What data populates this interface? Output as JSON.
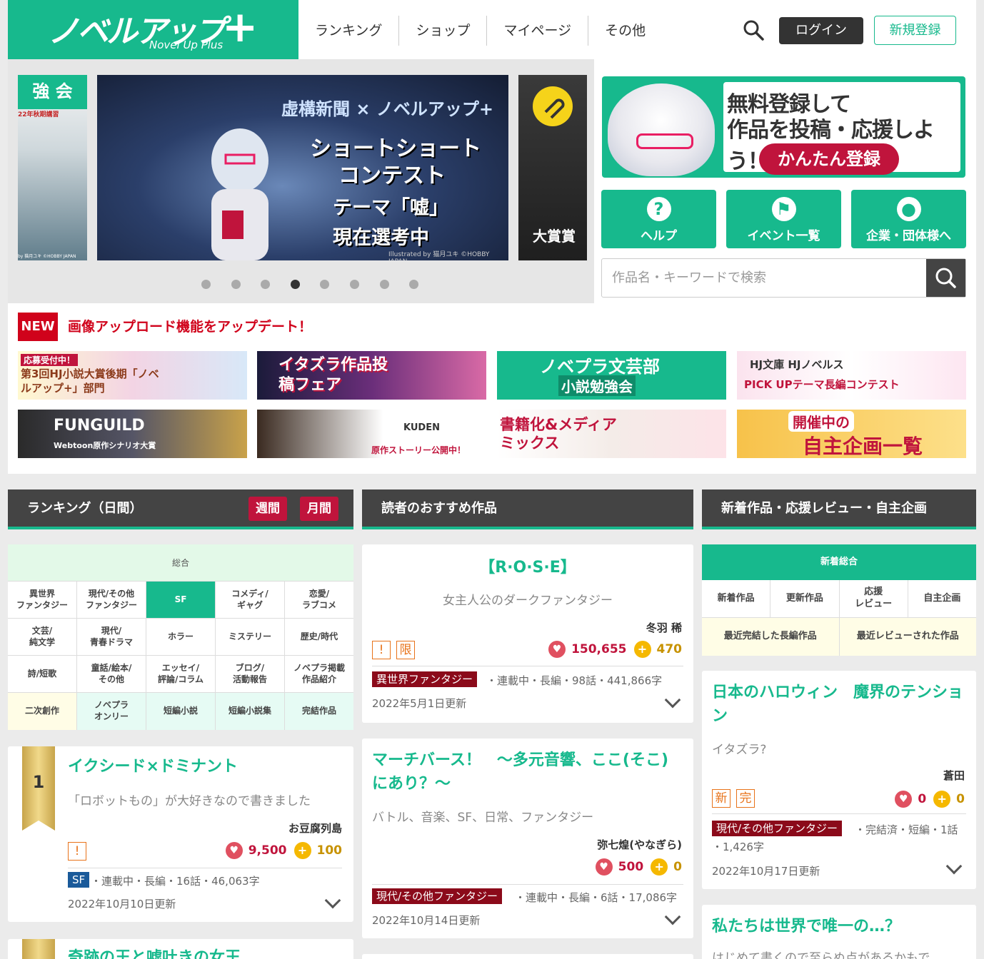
{
  "header": {
    "logo_main": "ノベルアップ",
    "logo_sub": "Novel Up Plus",
    "nav": [
      "ランキング",
      "ショップ",
      "マイページ",
      "その他"
    ],
    "login": "ログイン",
    "register": "新規登録"
  },
  "carousel": {
    "main_title": "虚構新聞 × ノベルアップ+",
    "main_line1": "ショートショート",
    "main_line2": "コンテスト",
    "main_line3": "テーマ「嘘」",
    "main_line4": "現在選考中",
    "main_credit": "Illustrated by 猫月ユキ ©HOBBY JAPAN",
    "left_head": "強 会",
    "left_sub": "22年秋期講習",
    "left_credit": "by 猫月ユキ ©HOBBY JAPAN",
    "right_award": "大賞賞",
    "dot_count": 8,
    "active_dot": 3
  },
  "signup": {
    "line1": "無料登録して",
    "line2": "作品を投稿・応援しよう！",
    "button": "かんたん登録"
  },
  "quick_links": [
    {
      "icon": "question-icon",
      "glyph": "?",
      "label": "ヘルプ"
    },
    {
      "icon": "flag-icon",
      "glyph": "⚑",
      "label": "イベント一覧"
    },
    {
      "icon": "person-icon",
      "glyph": "●",
      "label": "企業・団体様へ"
    }
  ],
  "search": {
    "placeholder": "作品名・キーワードで検索"
  },
  "news": {
    "badge": "NEW",
    "text": "画像アップロード機能をアップデート！"
  },
  "banners": [
    {
      "text": "第3回HJ小説大賞後期「ノベルアップ+」部門",
      "tag": "応募受付中！"
    },
    {
      "text": "イタズラ作品投稿フェア"
    },
    {
      "text": "ノベプラ文芸部",
      "sub": "小説勉強会"
    },
    {
      "text": "HJ文庫 HJノベルス",
      "sub": "PICK UPテーマ長編コンテスト"
    },
    {
      "text": "FUNGUILD",
      "sub": "Webtoon原作シナリオ大賞"
    },
    {
      "text": "KUDEN",
      "sub": "原作ストーリー公開中！"
    },
    {
      "text": "書籍化&メディアミックス"
    },
    {
      "text": "開催中の",
      "sub": "自主企画一覧"
    }
  ],
  "ranking": {
    "heading": "ランキング（日間）",
    "weekly": "週間",
    "monthly": "月間",
    "overall": "総合",
    "categories": [
      [
        "異世界\nファンタジー",
        "現代/その他\nファンタジー",
        "SF",
        "コメディ/\nギャグ",
        "恋愛/\nラブコメ"
      ],
      [
        "文芸/\n純文学",
        "現代/\n青春ドラマ",
        "ホラー",
        "ミステリー",
        "歴史/時代"
      ],
      [
        "詩/短歌",
        "童話/絵本/\nその他",
        "エッセイ/\n評論/コラム",
        "ブログ/\n活動報告",
        "ノベプラ掲載\n作品紹介"
      ],
      [
        "二次創作",
        "ノベプラ\nオンリー",
        "短編小説",
        "短編小説集",
        "完結作品"
      ]
    ],
    "first": {
      "rank": "1",
      "title": "イクシード×ドミナント",
      "desc": "「ロボットもの」が大好きなので書きました",
      "author": "お豆腐列島",
      "warn": "!",
      "hearts": "9,500",
      "coins": "100",
      "genre": "SF",
      "meta": "・連載中・長編・16話・46,063字",
      "date": "2022年10月10日更新"
    },
    "second": {
      "title": "奇跡の王と嘘吐きの女王"
    }
  },
  "recommend": {
    "heading": "読者のおすすめ作品",
    "items": [
      {
        "title": "【R·O·S·E】",
        "desc": "女主人公のダークファンタジー",
        "author": "冬羽 稀",
        "warn": "!",
        "limit": "限",
        "hearts": "150,655",
        "coins": "470",
        "genre": "異世界ファンタジー",
        "meta": "・連載中・長編・98話・441,866字",
        "date": "2022年5月1日更新"
      },
      {
        "title": "マーチバース！　～多元音響、ここ(そこ)にあり？～",
        "desc": "バトル、音楽、SF、日常、ファンタジー",
        "author": "弥七煌(やなぎら)",
        "hearts": "500",
        "coins": "0",
        "genre": "現代/その他ファンタジー",
        "meta": "・連載中・長編・6話・17,086字",
        "date": "2022年10月14日更新"
      }
    ]
  },
  "newest": {
    "heading": "新着作品・応援レビュー・自主企画",
    "tab": "新着総合",
    "row1": [
      "新着作品",
      "更新作品",
      "応援\nレビュー",
      "自主企画"
    ],
    "row2": [
      "最近完結した長編作品",
      "最近レビューされた作品"
    ],
    "items": [
      {
        "title": "日本のハロウィン　魔界のテンション",
        "desc": "イタズラ?",
        "author": "蒼田",
        "new": "新",
        "done": "完",
        "hearts": "0",
        "coins": "0",
        "genre": "現代/その他ファンタジー",
        "meta": "・完結済・短編・1話",
        "meta2": "・1,426字",
        "date": "2022年10月17日更新"
      },
      {
        "title": "私たちは世界で唯一の…？",
        "desc": "はじめて書くので至らぬ点があるかもで"
      }
    ]
  }
}
